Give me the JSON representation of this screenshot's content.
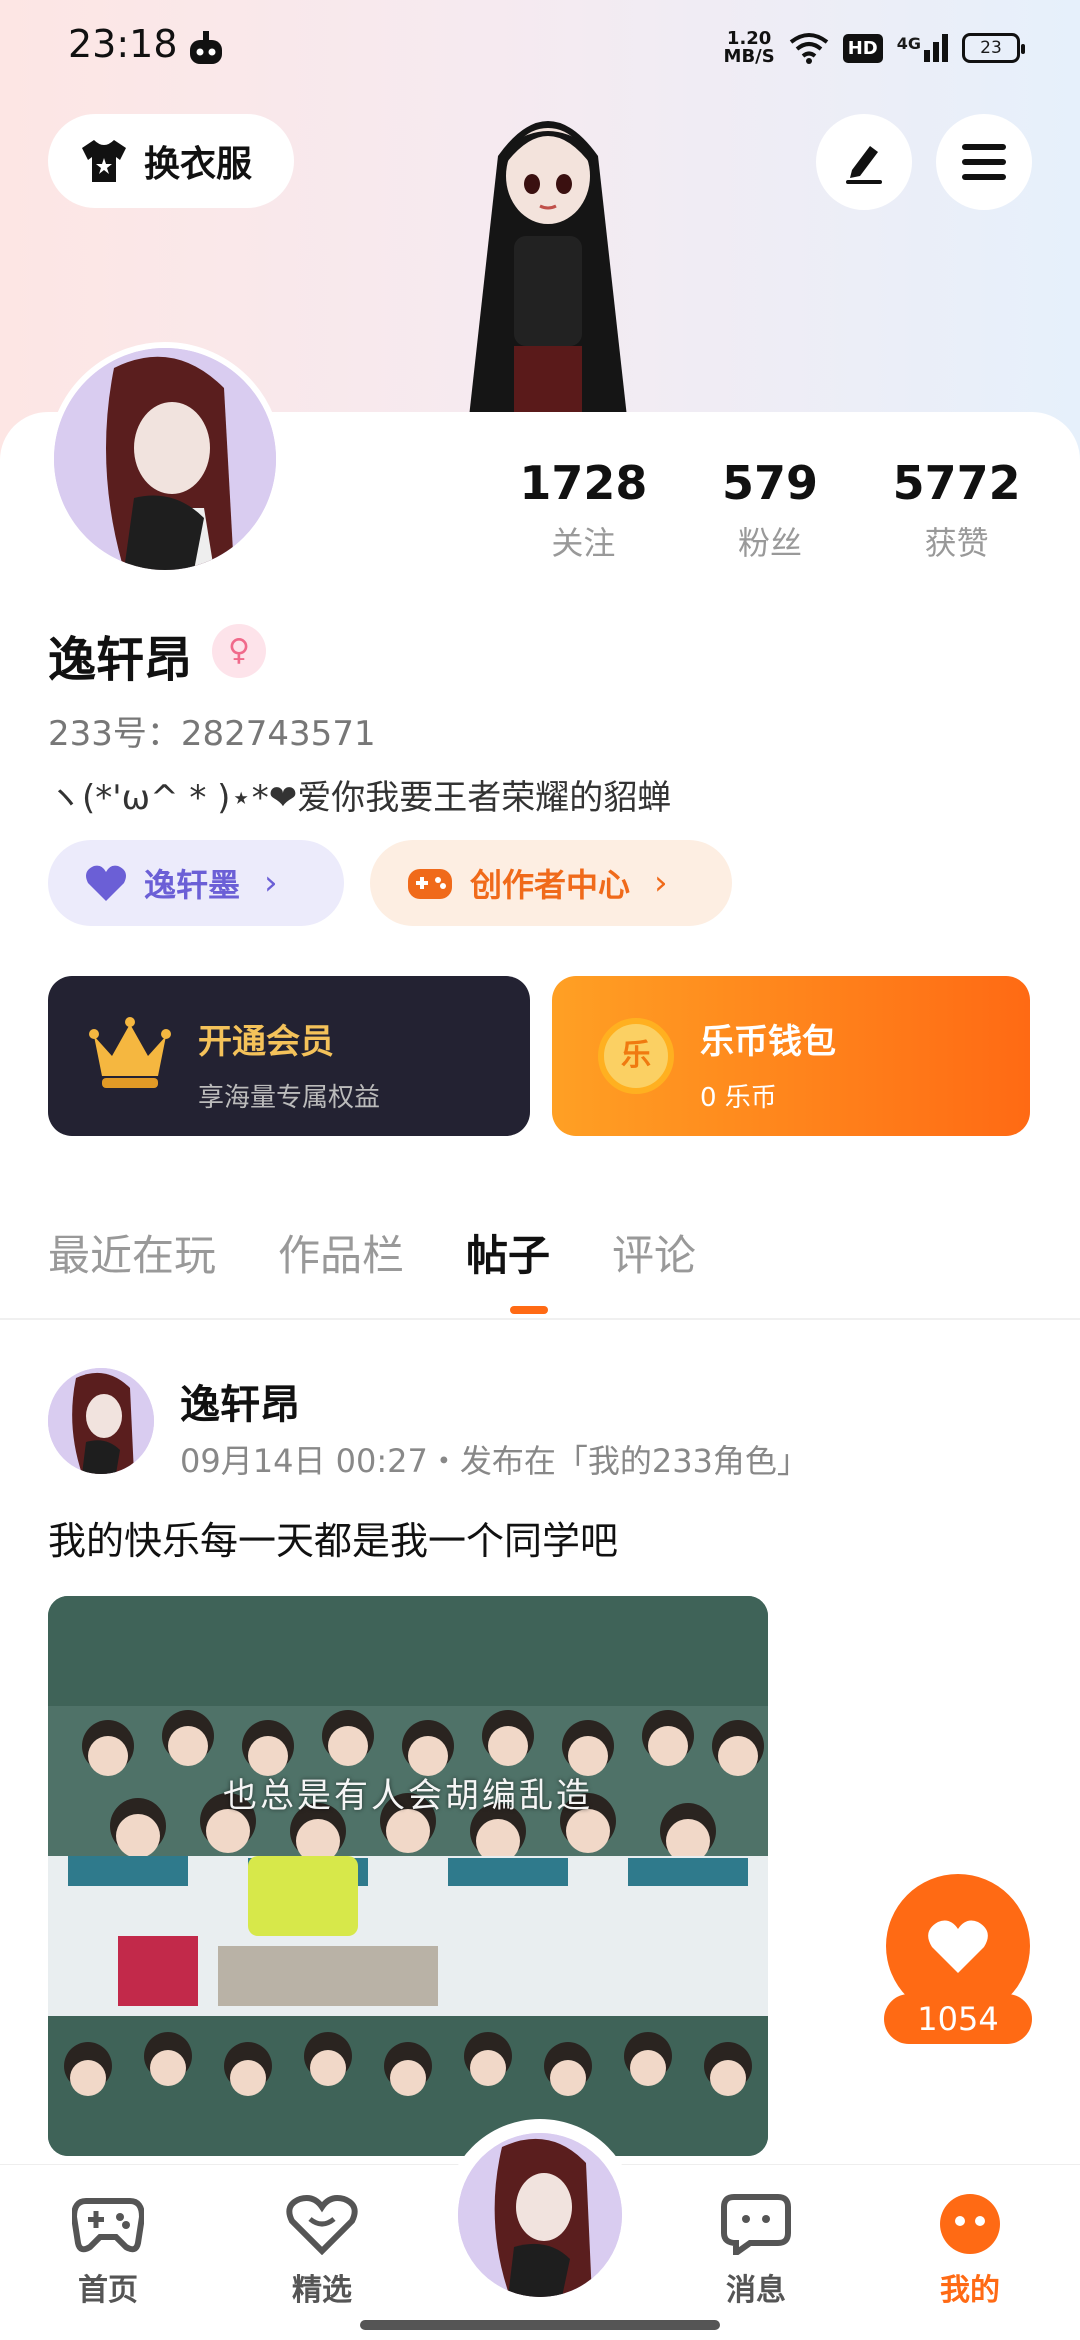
{
  "status_bar": {
    "time": "23:18",
    "speed_value": "1.20",
    "speed_unit": "MB/S",
    "hd": "HD",
    "network": "4G",
    "battery": "23"
  },
  "header": {
    "dress_label": "换衣服",
    "edit_icon": "pencil-icon",
    "menu_icon": "hamburger-menu-icon"
  },
  "profile": {
    "stats": [
      {
        "value": "1728",
        "label": "关注"
      },
      {
        "value": "579",
        "label": "粉丝"
      },
      {
        "value": "5772",
        "label": "获赞"
      }
    ],
    "nickname": "逸轩昂",
    "gender_symbol": "♀",
    "uid": "233号：282743571",
    "bio": "ヽ(*'ω^ * )⋆*❤爱你我要王者荣耀的貂蝉",
    "pill_purple": "逸轩墨",
    "pill_orange": "创作者中心",
    "chevron": "›"
  },
  "cards": {
    "vip_title": "开通会员",
    "vip_sub": "享海量专属权益",
    "wallet_title": "乐币钱包",
    "wallet_sub": "0 乐币",
    "coin_glyph": "乐"
  },
  "tabs": [
    "最近在玩",
    "作品栏",
    "帖子",
    "评论"
  ],
  "active_tab": "帖子",
  "post": {
    "author": "逸轩昂",
    "meta": "09月14日 00:27・发布在「我的233角色」",
    "text": "我的快乐每一天都是我一个同学吧",
    "image_subtitle": "也总是有人会胡编乱造",
    "like_count": "1054"
  },
  "nav": {
    "items": [
      {
        "label": "首页",
        "icon": "gamepad-icon"
      },
      {
        "label": "精选",
        "icon": "heart-chat-icon"
      },
      {
        "label": "消息",
        "icon": "message-icon"
      },
      {
        "label": "我的",
        "icon": "profile-face-icon"
      }
    ]
  },
  "colors": {
    "accent": "#ff6a14",
    "vip_bg": "#232232",
    "vip_gold": "#f4c25a",
    "purple": "#6b5fd6"
  }
}
